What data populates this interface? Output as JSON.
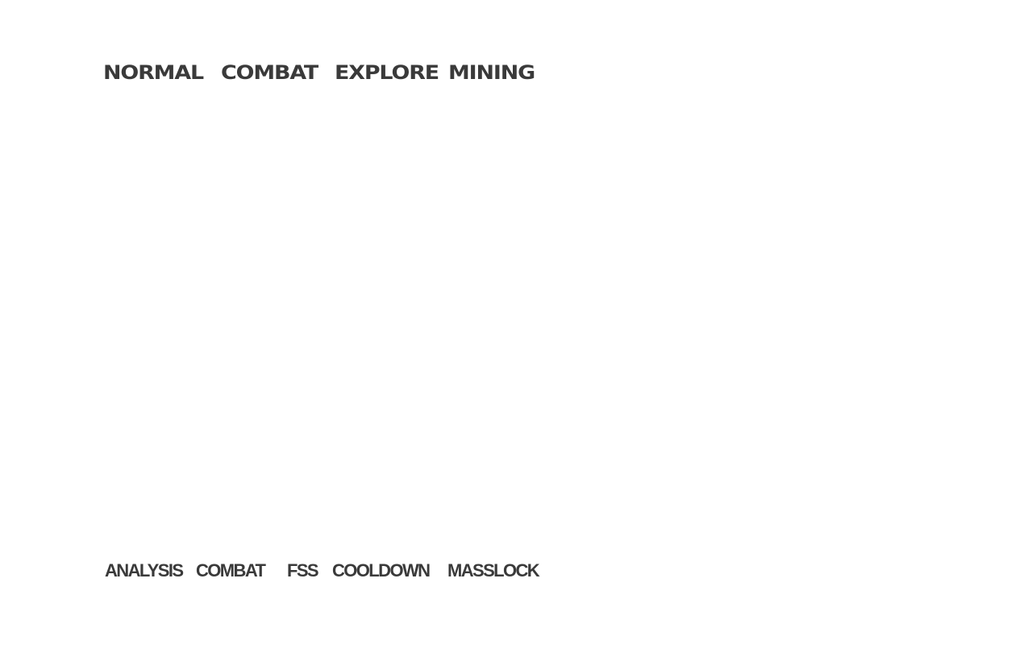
{
  "mode_tabs": {
    "normal": "NORMAL",
    "combat": "COMBAT",
    "explore": "EXPLORE",
    "mining": "MINING"
  },
  "status_indicators": {
    "analysis": "ANALYSIS",
    "combat": "COMBAT",
    "fss": "FSS",
    "cooldown": "COOLDOWN",
    "masslock": "MASSLOCK"
  },
  "colors": {
    "text": "#3a3a3a",
    "background": "#ffffff"
  }
}
